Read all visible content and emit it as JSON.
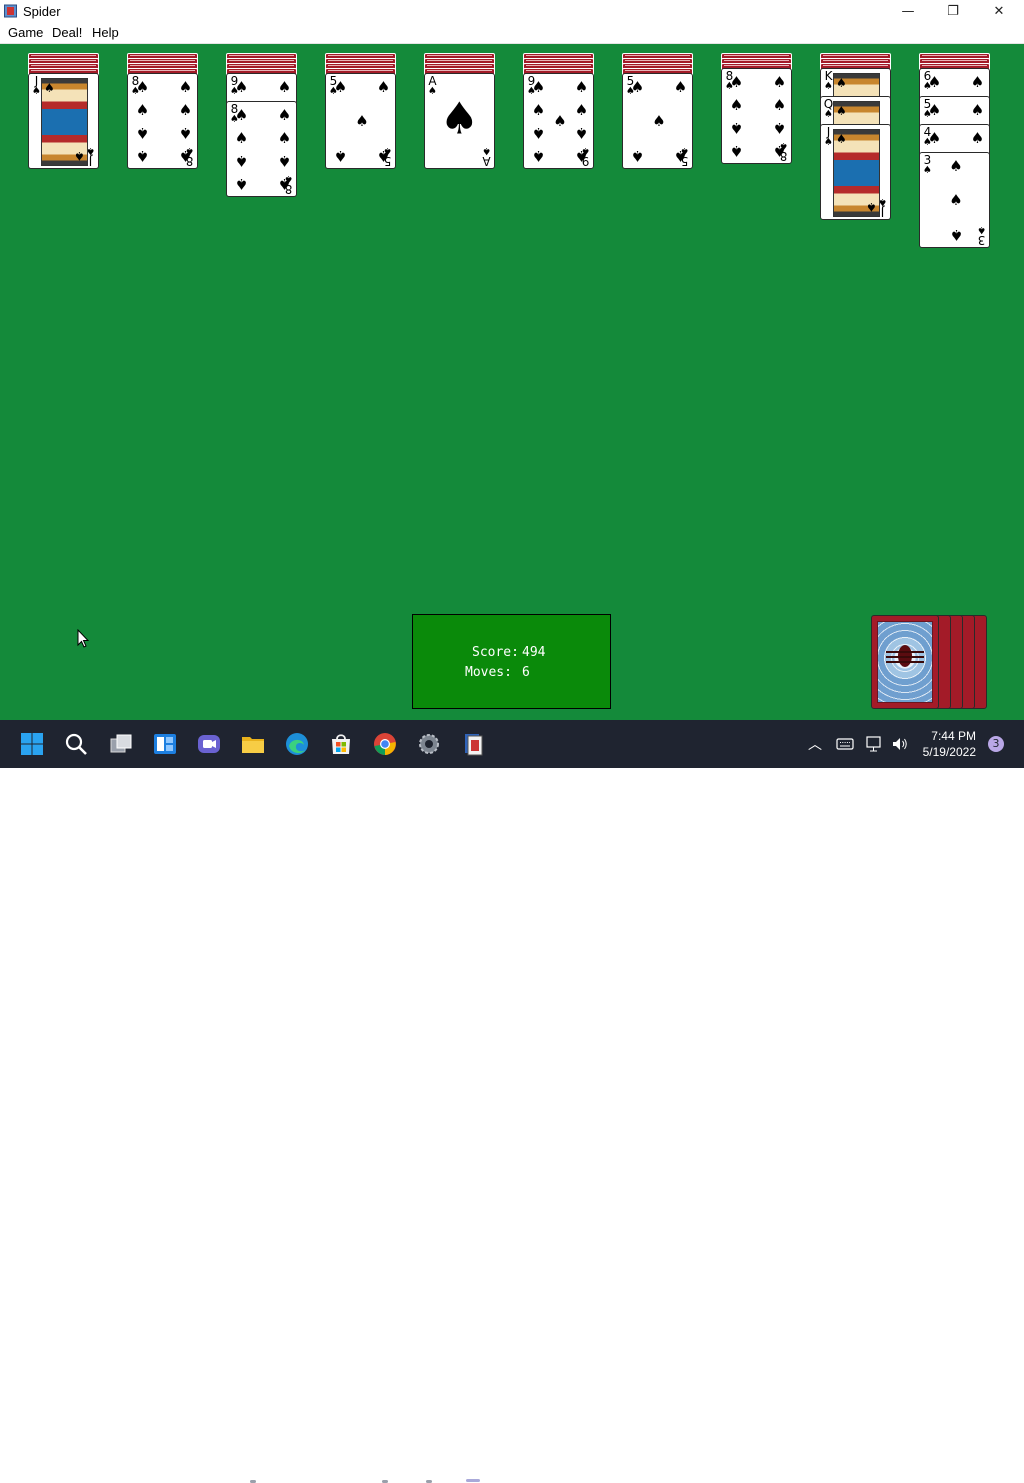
{
  "window": {
    "title": "Spider",
    "minimize_glyph": "—",
    "restore_glyph": "❐",
    "close_glyph": "✕"
  },
  "menu": [
    {
      "label": "Game"
    },
    {
      "label": "Deal!"
    },
    {
      "label": "Help"
    }
  ],
  "tableau": [
    {
      "facedown": 4,
      "cards": [
        {
          "rank": "J",
          "suit": "♠"
        }
      ]
    },
    {
      "facedown": 4,
      "cards": [
        {
          "rank": "8",
          "suit": "♠"
        }
      ]
    },
    {
      "facedown": 4,
      "cards": [
        {
          "rank": "9",
          "suit": "♠"
        },
        {
          "rank": "8",
          "suit": "♠"
        }
      ]
    },
    {
      "facedown": 4,
      "cards": [
        {
          "rank": "5",
          "suit": "♠"
        }
      ]
    },
    {
      "facedown": 4,
      "cards": [
        {
          "rank": "A",
          "suit": "♠"
        }
      ]
    },
    {
      "facedown": 4,
      "cards": [
        {
          "rank": "9",
          "suit": "♠"
        }
      ]
    },
    {
      "facedown": 4,
      "cards": [
        {
          "rank": "5",
          "suit": "♠"
        }
      ]
    },
    {
      "facedown": 3,
      "cards": [
        {
          "rank": "8",
          "suit": "♠"
        }
      ]
    },
    {
      "facedown": 3,
      "cards": [
        {
          "rank": "K",
          "suit": "♠"
        },
        {
          "rank": "Q",
          "suit": "♠"
        },
        {
          "rank": "J",
          "suit": "♠"
        }
      ]
    },
    {
      "facedown": 3,
      "cards": [
        {
          "rank": "6",
          "suit": "♠"
        },
        {
          "rank": "5",
          "suit": "♠"
        },
        {
          "rank": "4",
          "suit": "♠"
        },
        {
          "rank": "3",
          "suit": "♠"
        }
      ]
    }
  ],
  "status": {
    "score_label": "Score:",
    "score": "494",
    "moves_label": "Moves:",
    "moves": "6"
  },
  "stock": {
    "remaining_deals": 5
  },
  "taskbar": {
    "apps": [
      "start-icon",
      "search-icon",
      "task-view-icon",
      "widgets-icon",
      "teams-chat-icon",
      "file-explorer-icon",
      "edge-icon",
      "store-icon",
      "chrome-icon",
      "settings-icon",
      "spider-solitaire-icon"
    ],
    "time": "7:44 PM",
    "date": "5/19/2022",
    "notifications": "3"
  },
  "colors": {
    "felt": "#148a3a",
    "card_back": "#a31b28",
    "score_box": "#0a8a0a",
    "taskbar": "#1f2430"
  }
}
